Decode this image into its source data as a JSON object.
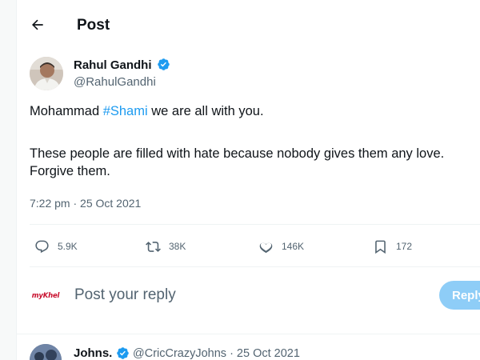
{
  "header": {
    "title": "Post"
  },
  "tweet": {
    "author": {
      "name": "Rahul Gandhi",
      "handle": "@RahulGandhi"
    },
    "text": {
      "line1_before": "Mohammad ",
      "line1_hashtag": "#Shami",
      "line1_after": " we are all with you.",
      "line2": "These people are filled with hate because nobody gives them any love.",
      "line3": "Forgive them."
    },
    "timestamp": "7:22 pm · 25 Oct 2021",
    "stats": {
      "replies": "5.9K",
      "reposts": "38K",
      "likes": "146K",
      "bookmarks": "172"
    }
  },
  "reply_box": {
    "avatar_text": "myKhel",
    "placeholder": "Post your reply",
    "button_label": "Reply"
  },
  "next_tweet": {
    "name": "Johns.",
    "meta": "@CricCrazyJohns · 25 Oct 2021"
  },
  "colors": {
    "accent": "#1d9bf0",
    "muted": "#536471",
    "reply_button": "#8ecdf7"
  }
}
